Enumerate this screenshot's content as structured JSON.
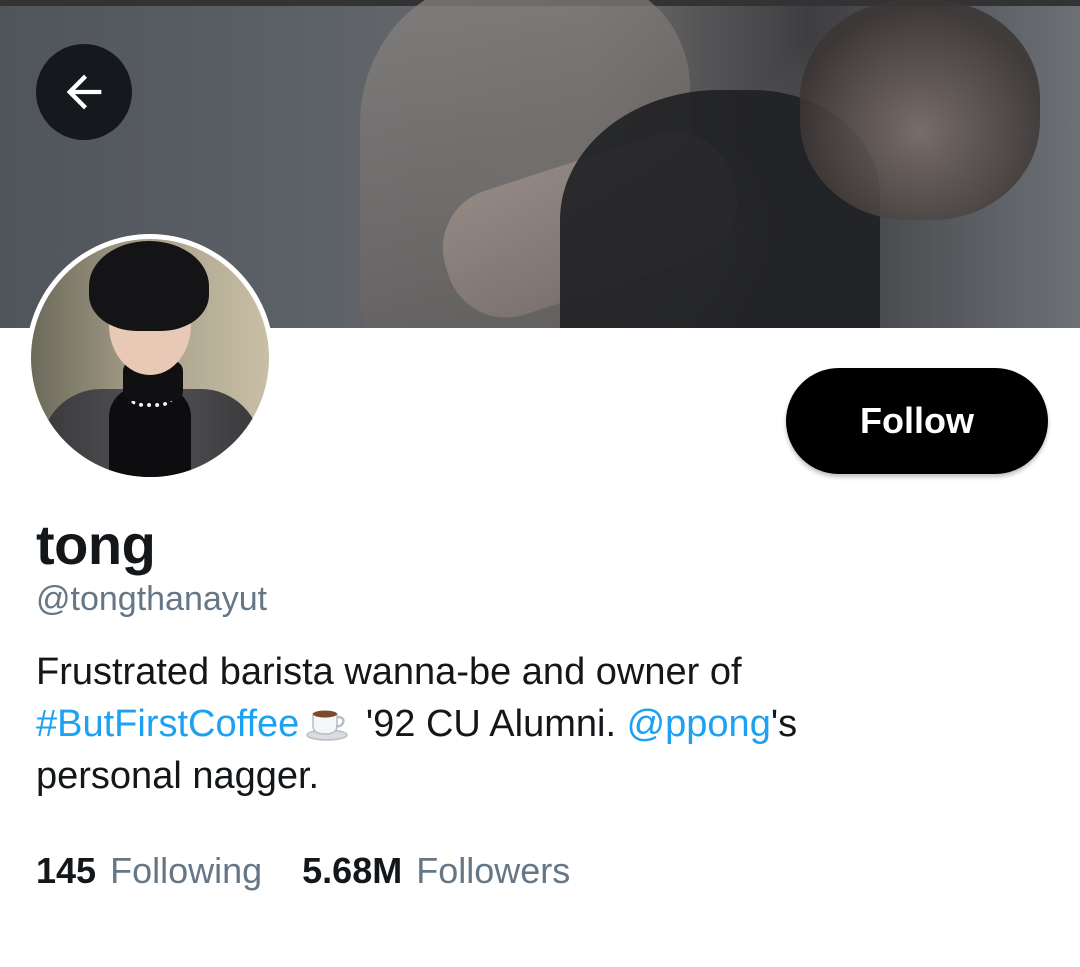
{
  "header": {
    "back_label": "Back"
  },
  "profile": {
    "name": "tong",
    "handle": "@tongthanayut",
    "follow_label": "Follow",
    "bio": {
      "line1": "Frustrated barista wanna-be and owner of",
      "hashtag": "#ButFirstCoffee",
      "emoji": "coffee-cup-icon",
      "middle": "'92 CU Alumni.",
      "mention": "@ppong",
      "mention_suffix": "'s",
      "line3": "personal nagger."
    },
    "stats": {
      "following_count": "145",
      "following_label": "Following",
      "followers_count": "5.68M",
      "followers_label": "Followers"
    }
  },
  "colors": {
    "link": "#1da1f2",
    "secondary_text": "#657786",
    "primary_text": "#14171a",
    "follow_bg": "#000000"
  }
}
